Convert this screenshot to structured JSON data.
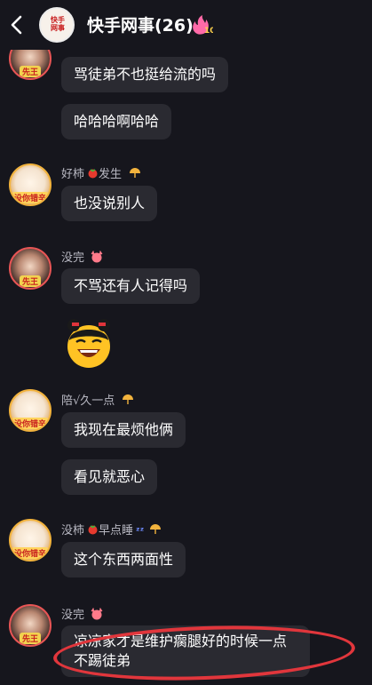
{
  "header": {
    "title": "快手网事(26)",
    "fire_level": "10",
    "group_avatar_text": "快手\n网事"
  },
  "messages": [
    {
      "tag": "先王",
      "text1": "骂徒弟不也挺给流的吗",
      "text2": "哈哈哈啊哈哈"
    },
    {
      "nick": "好柿",
      "nick_suffix": "发生",
      "tag": "没你错辛",
      "text": "也没说别人"
    },
    {
      "nick": "没完",
      "tag": "先王",
      "text": "不骂还有人记得吗"
    },
    {
      "nick": "陪√久一点",
      "tag": "没你错辛",
      "text1": "我现在最烦他俩",
      "text2": "看见就恶心"
    },
    {
      "nick": "没柿",
      "nick_suffix": "早点睡",
      "tag": "没你错辛",
      "text": "这个东西两面性"
    },
    {
      "nick": "没完",
      "tag": "先王",
      "text": "凉凉家才是维护瘸腿好的时候一点不踢徒弟"
    }
  ],
  "colors": {
    "background": "#16161d",
    "bubble": "#2a2a31",
    "nick": "#b8b8c2",
    "annotation": "#e1363c"
  }
}
